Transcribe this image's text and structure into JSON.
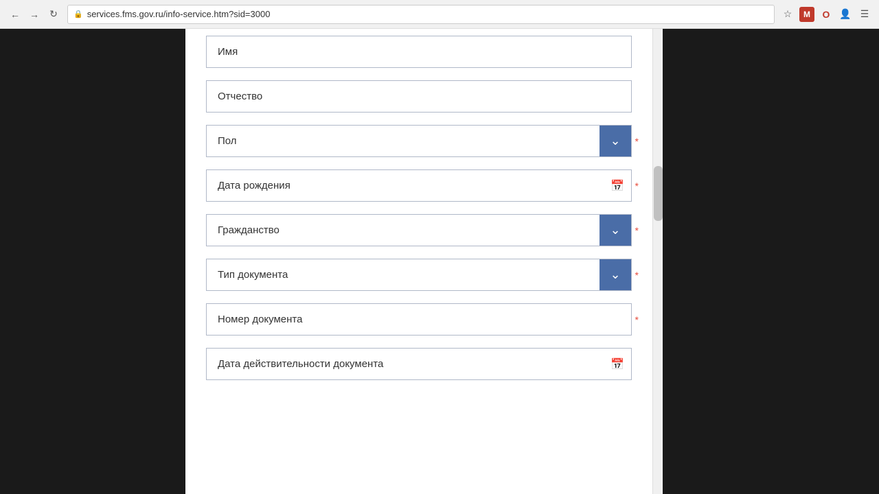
{
  "browser": {
    "url": "services.fms.gov.ru/info-service.htm?sid=3000",
    "back_title": "back",
    "forward_title": "forward",
    "reload_title": "reload"
  },
  "form": {
    "fields": [
      {
        "id": "imya",
        "placeholder": "Имя",
        "type": "text",
        "has_dropdown": false,
        "has_calendar": false,
        "required": false,
        "value": ""
      },
      {
        "id": "otchestvo",
        "placeholder": "Отчество",
        "type": "text",
        "has_dropdown": false,
        "has_calendar": false,
        "required": false,
        "value": ""
      },
      {
        "id": "pol",
        "placeholder": "Пол",
        "type": "dropdown",
        "has_dropdown": true,
        "has_calendar": false,
        "required": true,
        "value": ""
      },
      {
        "id": "data-rozhdeniya",
        "placeholder": "Дата рождения",
        "type": "date",
        "has_dropdown": false,
        "has_calendar": true,
        "required": true,
        "value": ""
      },
      {
        "id": "grazhdanstvo",
        "placeholder": "Гражданство",
        "type": "dropdown",
        "has_dropdown": true,
        "has_calendar": false,
        "required": true,
        "value": ""
      },
      {
        "id": "tip-dokumenta",
        "placeholder": "Тип документа",
        "type": "dropdown",
        "has_dropdown": true,
        "has_calendar": false,
        "required": true,
        "value": ""
      },
      {
        "id": "nomer-dokumenta",
        "placeholder": "Номер документа",
        "type": "text",
        "has_dropdown": false,
        "has_calendar": false,
        "required": true,
        "value": ""
      },
      {
        "id": "data-deystvitelnosti",
        "placeholder": "Дата действительности документа",
        "type": "date",
        "has_dropdown": false,
        "has_calendar": true,
        "required": false,
        "value": ""
      }
    ]
  }
}
